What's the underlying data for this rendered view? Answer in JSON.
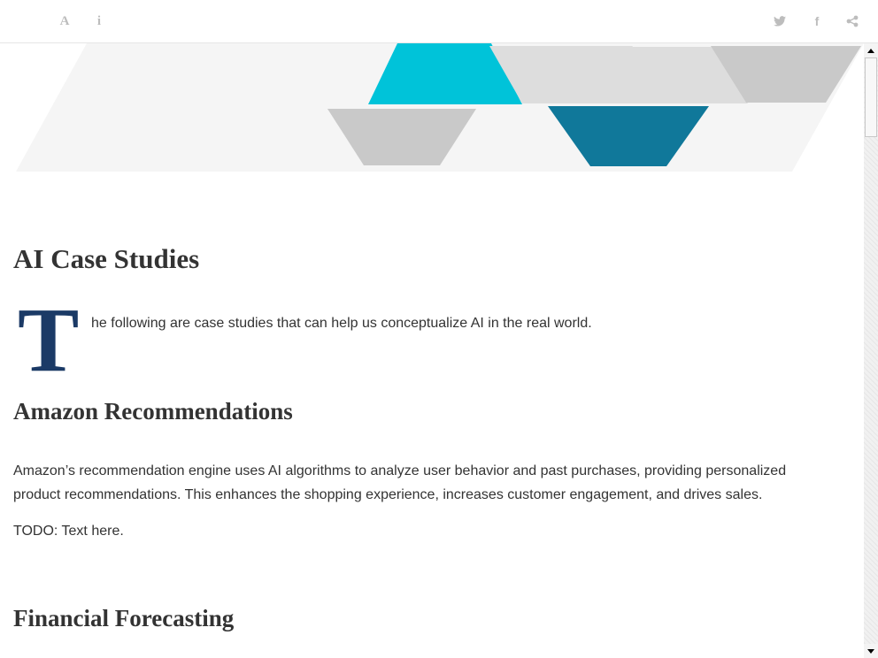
{
  "toolbar": {
    "left_icons": [
      "font-icon",
      "info-icon"
    ],
    "right_icons": [
      "twitter-icon",
      "facebook-icon",
      "share-icon"
    ],
    "font_glyph": "A",
    "info_glyph": "i",
    "facebook_glyph": "f"
  },
  "banner": {
    "colors": {
      "background": "#f5f5f5",
      "cyan": "#00c3d9",
      "teal": "#10789a",
      "gray": "#c9c9c9",
      "light_gray": "#dddddd"
    }
  },
  "article": {
    "title": "AI Case Studies",
    "dropcap": "T",
    "intro": "he following are case studies that can help us conceptualize AI in the real world.",
    "sections": [
      {
        "heading": "Amazon Recommendations",
        "paragraphs": [
          "Amazon’s recommendation engine uses AI algorithms to analyze user behavior and past purchases, providing personalized product recommendations. This enhances the shopping experience, increases customer engagement, and drives sales.",
          "TODO: Text here."
        ]
      },
      {
        "heading": "Financial Forecasting"
      }
    ]
  },
  "colors": {
    "text": "#333333",
    "dropcap": "#1b3a66",
    "icon": "#bdbdbd"
  },
  "scrollbar": {
    "icons": [
      "scroll-up-arrow-icon",
      "scroll-down-arrow-icon"
    ]
  }
}
